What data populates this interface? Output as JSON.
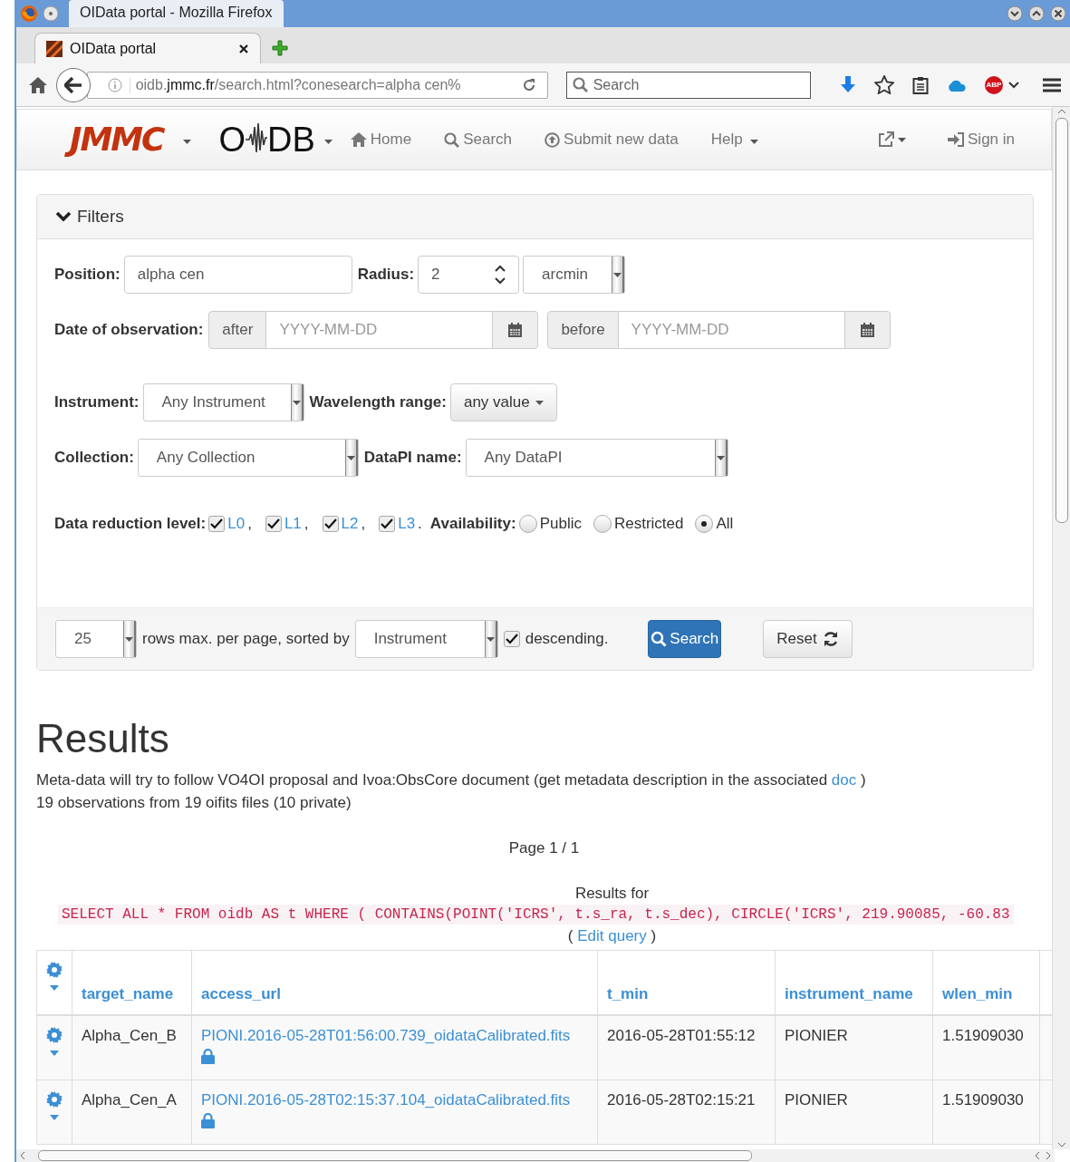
{
  "browser": {
    "window_title": "OIData portal - Mozilla Firefox",
    "tab_title": "OIData portal",
    "url": {
      "prefix": "oidb.",
      "host": "jmmc.fr",
      "path": "/search.html?conesearch=alpha cen%"
    },
    "search_placeholder": "Search",
    "addon_badge": "ABP"
  },
  "navbar": {
    "logo": "JMMC",
    "brand_left": "O",
    "brand_right": "DB",
    "items": [
      {
        "kind": "home",
        "label": "Home"
      },
      {
        "kind": "search",
        "label": "Search"
      },
      {
        "kind": "upload",
        "label": "Submit new data"
      },
      {
        "kind": "menu",
        "label": "Help"
      }
    ],
    "sign_in": "Sign in"
  },
  "filters": {
    "title": "Filters",
    "expanded": true,
    "position": {
      "label": "Position:",
      "value": "alpha cen"
    },
    "radius": {
      "label": "Radius:",
      "value": "2",
      "unit": "arcmin"
    },
    "date": {
      "label": "Date of observation:",
      "after": "after",
      "after_placeholder": "YYYY-MM-DD",
      "before": "before",
      "before_placeholder": "YYYY-MM-DD"
    },
    "instrument": {
      "label": "Instrument:",
      "value": "Any Instrument"
    },
    "wavelength": {
      "label": "Wavelength range:",
      "value": "any value"
    },
    "collection": {
      "label": "Collection:",
      "value": "Any Collection"
    },
    "datapi": {
      "label": "DataPI name:",
      "value": "Any DataPI"
    },
    "reduction": {
      "label": "Data reduction level:",
      "levels": [
        {
          "label": "L0",
          "suffix": ",",
          "checked": true
        },
        {
          "label": "L1",
          "suffix": ",",
          "checked": true
        },
        {
          "label": "L2",
          "suffix": ",",
          "checked": true
        },
        {
          "label": "L3",
          "suffix": ".",
          "checked": true
        }
      ]
    },
    "availability": {
      "label": "Availability:",
      "options": [
        {
          "label": "Public",
          "selected": false
        },
        {
          "label": "Restricted",
          "selected": false
        },
        {
          "label": "All",
          "selected": true
        }
      ]
    },
    "rows": "25",
    "rows_text": "rows max. per page, sorted by",
    "sort": "Instrument",
    "descending": {
      "label": "descending.",
      "checked": true
    },
    "search_button": "Search",
    "reset_button": "Reset"
  },
  "results": {
    "title": "Results",
    "description": "Meta-data will try to follow VO4OI proposal and Ivoa:ObsCore document (get metadata description in the associated",
    "doc_link": "doc",
    "description_end": ")",
    "count": "19 observations from 19 oifits files (10 private)",
    "page": "Page 1 / 1",
    "results_for": "Results for",
    "query": "SELECT ALL * FROM oidb AS t WHERE ( CONTAINS(POINT('ICRS', t.s_ra, t.s_dec), CIRCLE('ICRS', 219.90085, -60.83",
    "edit_open": "(",
    "edit_link": "Edit query",
    "edit_close": ")"
  },
  "table": {
    "columns": [
      "target_name",
      "access_url",
      "t_min",
      "instrument_name",
      "wlen_min"
    ],
    "rows": [
      {
        "cells": [
          "Alpha_Cen_B",
          "PIONI.2016-05-28T01:56:00.739_oidataCalibrated.fits",
          "2016-05-28T01:55:12",
          "PIONIER",
          "1.51909030"
        ],
        "private": true
      },
      {
        "cells": [
          "Alpha_Cen_A",
          "PIONI.2016-05-28T02:15:37.104_oidataCalibrated.fits",
          "2016-05-28T02:15:21",
          "PIONIER",
          "1.51909030"
        ],
        "private": true
      }
    ]
  }
}
